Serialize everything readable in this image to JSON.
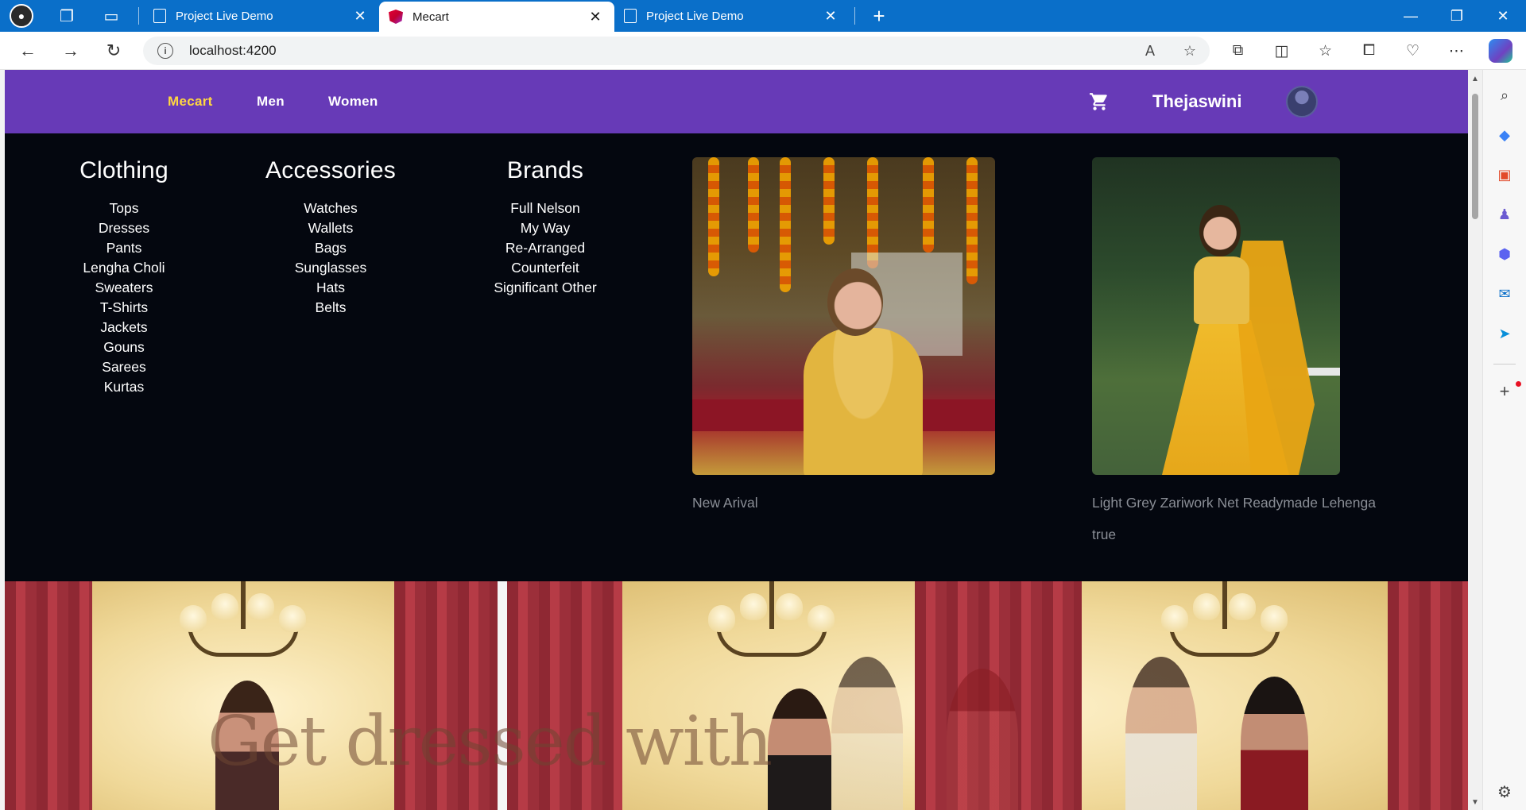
{
  "browser": {
    "tabs": [
      {
        "title": "Project Live Demo",
        "icon": "page-icon",
        "active": false
      },
      {
        "title": "Mecart",
        "icon": "angular-icon",
        "active": true
      },
      {
        "title": "Project Live Demo",
        "icon": "page-icon",
        "active": false
      }
    ],
    "url": "localhost:4200"
  },
  "navbar": {
    "brand": "Mecart",
    "links": [
      "Men",
      "Women"
    ],
    "cart_icon": "shopping-cart-icon",
    "user_name": "Thejaswini",
    "colors": {
      "background": "#673ab7",
      "brand": "#ffd740"
    }
  },
  "mega_menu": {
    "columns": [
      {
        "heading": "Clothing",
        "items": [
          "Tops",
          "Dresses",
          "Pants",
          "Lengha Choli",
          "Sweaters",
          "T-Shirts",
          "Jackets",
          "Gouns",
          "Sarees",
          "Kurtas"
        ]
      },
      {
        "heading": "Accessories",
        "items": [
          "Watches",
          "Wallets",
          "Bags",
          "Sunglasses",
          "Hats",
          "Belts"
        ]
      },
      {
        "heading": "Brands",
        "items": [
          "Full Nelson",
          "My Way",
          "Re-Arranged",
          "Counterfeit",
          "Significant Other"
        ]
      }
    ],
    "promos": [
      {
        "caption": "New Arival"
      },
      {
        "caption": "Light Grey Zariwork Net Readymade Lehenga",
        "extra": "true"
      }
    ]
  },
  "hero": {
    "text": "Get dressed with"
  }
}
